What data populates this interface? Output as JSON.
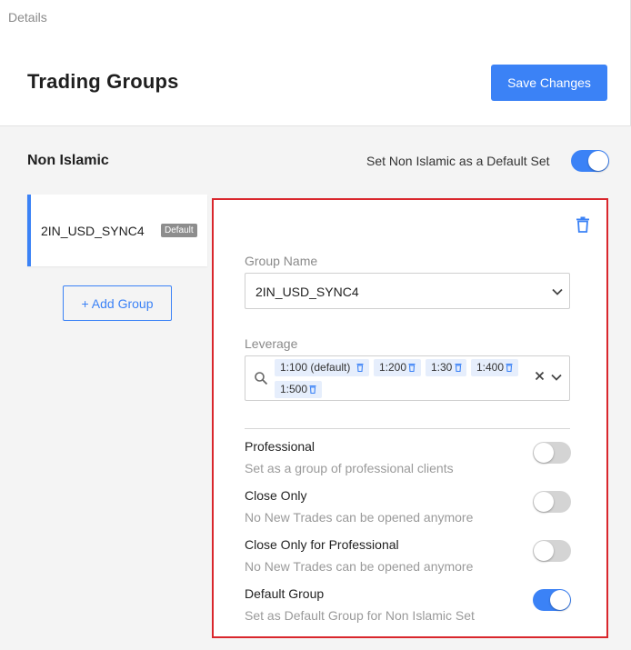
{
  "header": {
    "breadcrumb": "Details",
    "title": "Trading Groups",
    "save_label": "Save Changes"
  },
  "set": {
    "title": "Non Islamic",
    "default_set_label": "Set Non Islamic as a Default Set",
    "default_set_enabled": true
  },
  "groups": [
    {
      "name": "2IN_USD_SYNC4",
      "badge": "Default",
      "selected": true
    }
  ],
  "add_group_label": "+ Add Group",
  "panel": {
    "group_name_label": "Group Name",
    "group_name_value": "2IN_USD_SYNC4",
    "leverage_label": "Leverage",
    "leverage_options": [
      "1:100 (default)",
      "1:200",
      "1:30",
      "1:400",
      "1:500"
    ],
    "options": [
      {
        "title": "Professional",
        "description": "Set as a group of professional clients",
        "enabled": false
      },
      {
        "title": "Close Only",
        "description": "No New Trades can be opened anymore",
        "enabled": false
      },
      {
        "title": "Close Only for Professional",
        "description": "No New Trades can be opened anymore",
        "enabled": false
      },
      {
        "title": "Default Group",
        "description": "Set as Default Group for Non Islamic Set",
        "enabled": true
      }
    ]
  },
  "colors": {
    "accent": "#3b82f6",
    "highlight_border": "#d9262c",
    "chip_background": "#e6eefc",
    "toggle_off": "#d4d4d4"
  }
}
